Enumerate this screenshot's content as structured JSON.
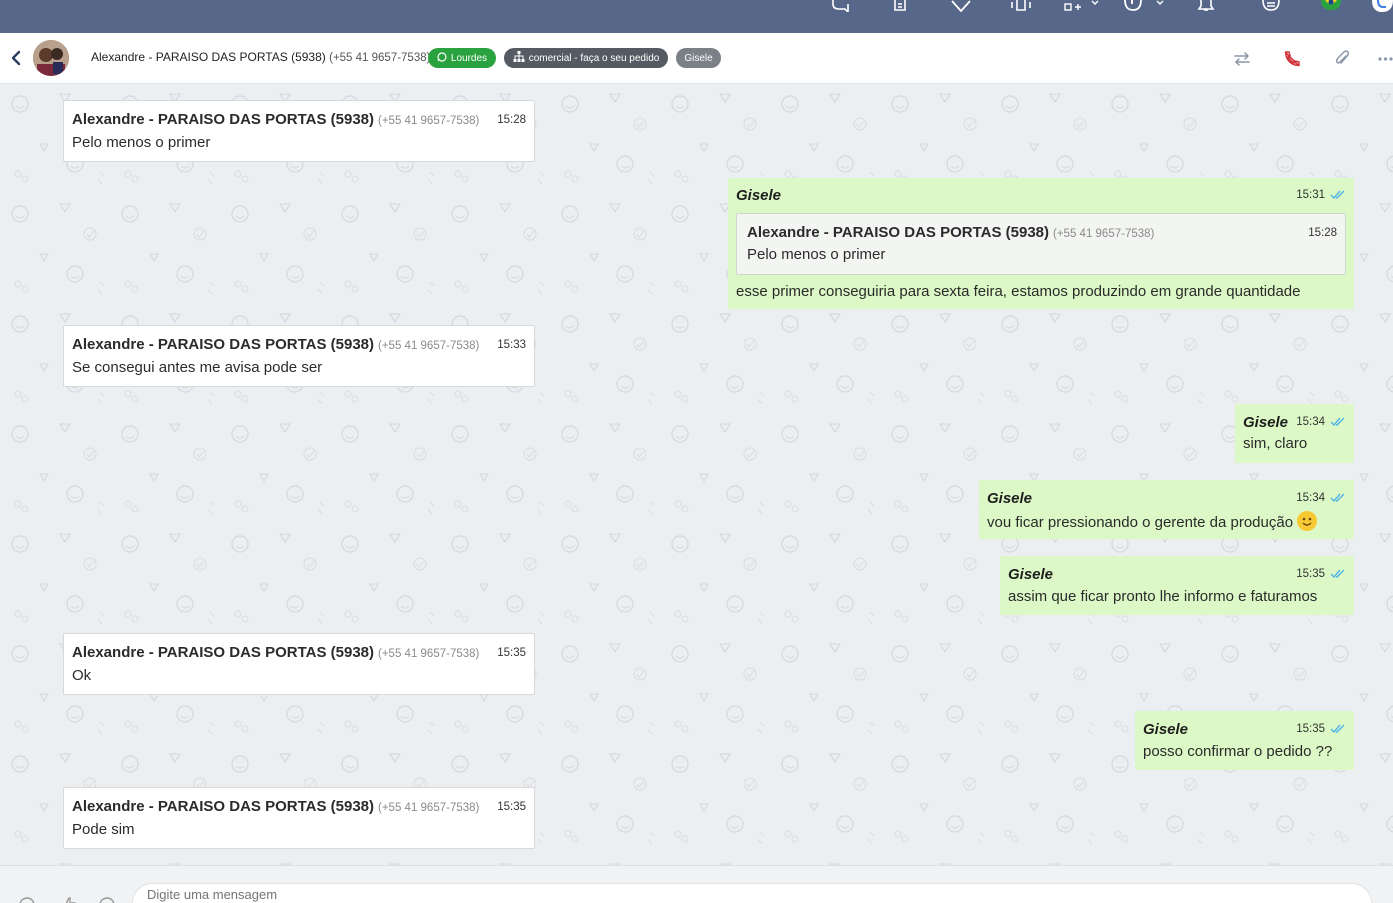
{
  "topbar": {
    "icons": [
      "chat-bubbles-icon",
      "clipboard-icon",
      "heart-icon",
      "phone-vibrate-icon",
      "add-widget-icon",
      "help-icon",
      "bell-icon",
      "menu-lines-icon",
      "brazil-flag-icon",
      "user-avatar-icon"
    ]
  },
  "header": {
    "contact_name": "Alexandre - PARAISO DAS PORTAS (5938)",
    "contact_phone": "(+55 41 9657-7538)",
    "tags": {
      "lourdes": "Lourdes",
      "comercial": "comercial - faça o seu pedido",
      "gisele": "Gisele"
    },
    "icons": [
      "transfer-icon",
      "end-call-icon",
      "attachment-icon",
      "more-icon"
    ]
  },
  "messages": {
    "m1": {
      "sender": "Alexandre - PARAISO DAS PORTAS (5938)",
      "phone": "(+55 41 9657-7538)",
      "time": "15:28",
      "text": "Pelo menos o primer"
    },
    "m2": {
      "sender": "Gisele",
      "time": "15:31",
      "quote": {
        "sender": "Alexandre - PARAISO DAS PORTAS (5938)",
        "phone": "(+55 41 9657-7538)",
        "time": "15:28",
        "text": "Pelo menos o primer"
      },
      "text": "esse primer conseguiria para sexta feira, estamos produzindo em grande quantidade"
    },
    "m3": {
      "sender": "Alexandre - PARAISO DAS PORTAS (5938)",
      "phone": "(+55 41 9657-7538)",
      "time": "15:33",
      "text": "Se consegui antes me avisa pode ser"
    },
    "m4": {
      "sender": "Gisele",
      "time": "15:34",
      "text": "sim, claro"
    },
    "m5": {
      "sender": "Gisele",
      "time": "15:34",
      "text": "vou ficar pressionando o gerente da produção"
    },
    "m6": {
      "sender": "Gisele",
      "time": "15:35",
      "text": "assim que ficar pronto lhe informo e faturamos"
    },
    "m7": {
      "sender": "Alexandre - PARAISO DAS PORTAS (5938)",
      "phone": "(+55 41 9657-7538)",
      "time": "15:35",
      "text": "Ok"
    },
    "m8": {
      "sender": "Gisele",
      "time": "15:35",
      "text": "posso confirmar o pedido ??"
    },
    "m9": {
      "sender": "Alexandre - PARAISO DAS PORTAS (5938)",
      "phone": "(+55 41 9657-7538)",
      "time": "15:35",
      "text": "Pode sim"
    }
  },
  "composer": {
    "placeholder": "Digite uma mensagem"
  },
  "colors": {
    "topbar": "#57678a",
    "outgoing_bubble": "#dcf8c6",
    "incoming_bubble": "#ffffff",
    "read_check": "#4fb3e8",
    "tag_lourdes": "#2aa23f",
    "tag_comercial": "#555b62",
    "tag_gisele": "#7b7f86",
    "end_call": "#d0343b"
  }
}
